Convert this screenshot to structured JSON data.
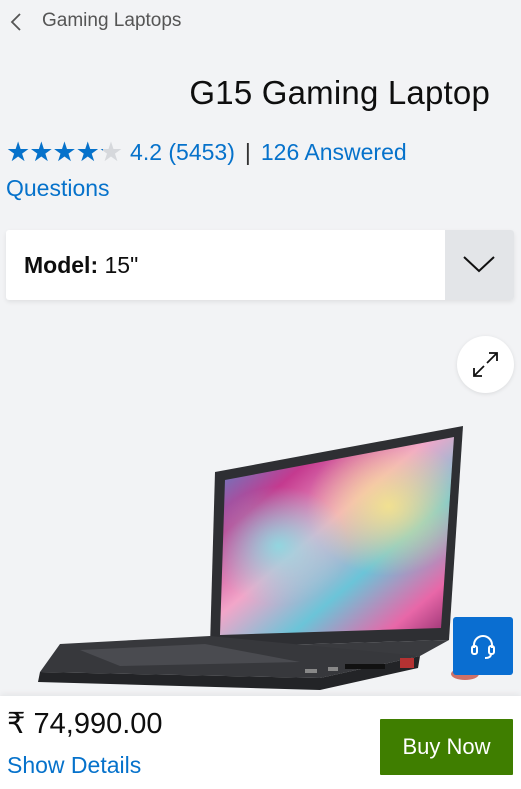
{
  "breadcrumb": {
    "back_icon": "chevron-left-icon",
    "label": "Gaming Laptops"
  },
  "product": {
    "title": "G15 Gaming Laptop"
  },
  "rating": {
    "stars": 4.2,
    "score_text": "4.2 (5453)",
    "separator": "|",
    "qa_text": "126 Answered Questions",
    "color": "#0672cb"
  },
  "model_select": {
    "label": "Model:",
    "value": "15\"",
    "icon": "chevron-down-icon"
  },
  "media": {
    "expand_icon": "expand-icon",
    "image": "laptop-product-image",
    "support_icon": "headset-icon"
  },
  "footer": {
    "price": "₹ 74,990.00",
    "details_link": "Show Details",
    "buy_label": "Buy Now",
    "buy_color": "#3f7e00"
  }
}
